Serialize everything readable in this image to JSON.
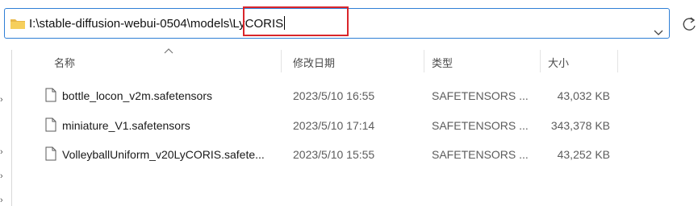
{
  "address_bar": {
    "path_prefix": "I:\\stable-diffusion-webui-0504\\models\\",
    "path_typed": "LyCORIS",
    "folder_icon": "folder-icon",
    "dropdown_icon": "chevron-down-icon",
    "refresh_icon": "refresh-icon",
    "highlight_color": "#d9262b"
  },
  "columns": {
    "name": "名称",
    "date": "修改日期",
    "type": "类型",
    "size": "大小"
  },
  "files": [
    {
      "name": "bottle_locon_v2m.safetensors",
      "date": "2023/5/10 16:55",
      "type": "SAFETENSORS ...",
      "size": "43,032 KB"
    },
    {
      "name": "miniature_V1.safetensors",
      "date": "2023/5/10 17:14",
      "type": "SAFETENSORS ...",
      "size": "343,378 KB"
    },
    {
      "name": "VolleyballUniform_v20LyCORIS.safete...",
      "date": "2023/5/10 15:55",
      "type": "SAFETENSORS ...",
      "size": "43,252 KB"
    }
  ]
}
